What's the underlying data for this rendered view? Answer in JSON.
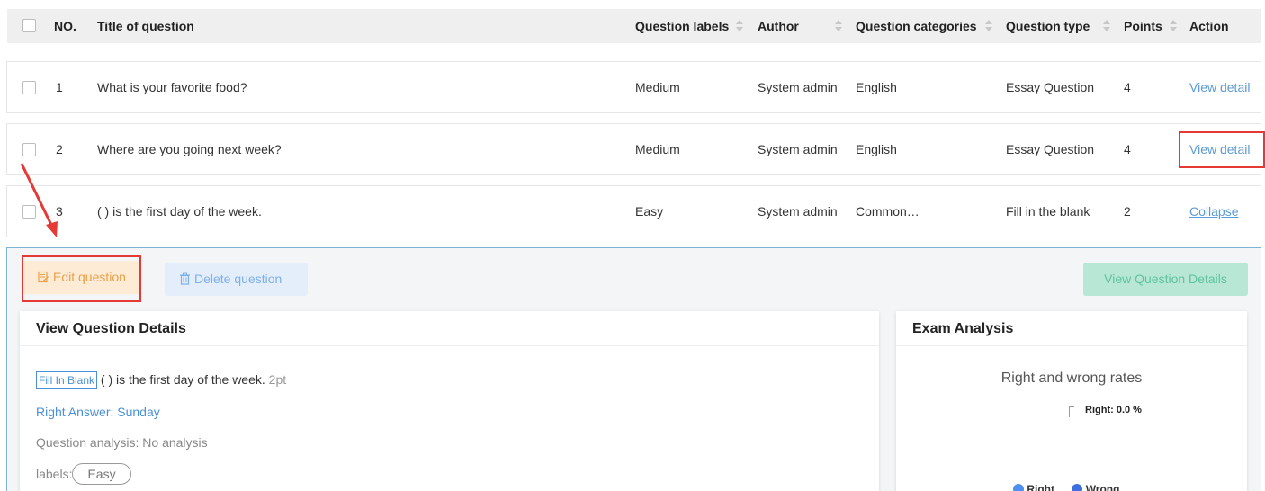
{
  "table": {
    "headers": {
      "no": "NO.",
      "title": "Title of question",
      "labels": "Question labels",
      "author": "Author",
      "categories": "Question categories",
      "type": "Question type",
      "points": "Points",
      "action": "Action"
    },
    "rows": [
      {
        "no": "1",
        "title": "What is your favorite food?",
        "label": "Medium",
        "author": "System admin",
        "category": "English",
        "type": "Essay Question",
        "points": "4",
        "action": "View detail"
      },
      {
        "no": "2",
        "title": "Where are you going next week?",
        "label": "Medium",
        "author": "System admin",
        "category": "English",
        "type": "Essay Question",
        "points": "4",
        "action": "View detail"
      },
      {
        "no": "3",
        "title": "( ) is the first day of the week.",
        "label": "Easy",
        "author": "System admin",
        "category": "Common…",
        "type": "Fill in the blank",
        "points": "2",
        "action": "Collapse"
      }
    ]
  },
  "panel": {
    "edit_button": "Edit question",
    "delete_button": "Delete question",
    "view_details_button": "View Question Details",
    "details_card": {
      "title": "View Question Details",
      "type_tag": "Fill In Blank",
      "question_text": "( ) is the first day of the week.",
      "points": "2pt",
      "right_answer": "Right Answer: Sunday",
      "analysis": "Question analysis: No analysis",
      "labels_prefix": "labels:",
      "label_pill": "Easy"
    },
    "analysis_card": {
      "title": "Exam Analysis",
      "chart_title": "Right and wrong rates",
      "tooltip": "Right: 0.0 %",
      "legend": [
        "Right",
        "Wrong"
      ]
    }
  },
  "colors": {
    "link": "#5b9bd5",
    "highlight": "#e53935",
    "edit_bg": "#fdebd6",
    "delete_bg": "#e4eefb",
    "view_bg": "#b9e7d6",
    "legend_right": "#4e8ff2",
    "legend_wrong": "#3d6fe0"
  },
  "chart_data": {
    "type": "pie",
    "title": "Right and wrong rates",
    "categories": [
      "Right",
      "Wrong"
    ],
    "values": [
      0.0,
      0.0
    ],
    "annotations": [
      "Right: 0.0 %"
    ],
    "legend_position": "bottom"
  }
}
